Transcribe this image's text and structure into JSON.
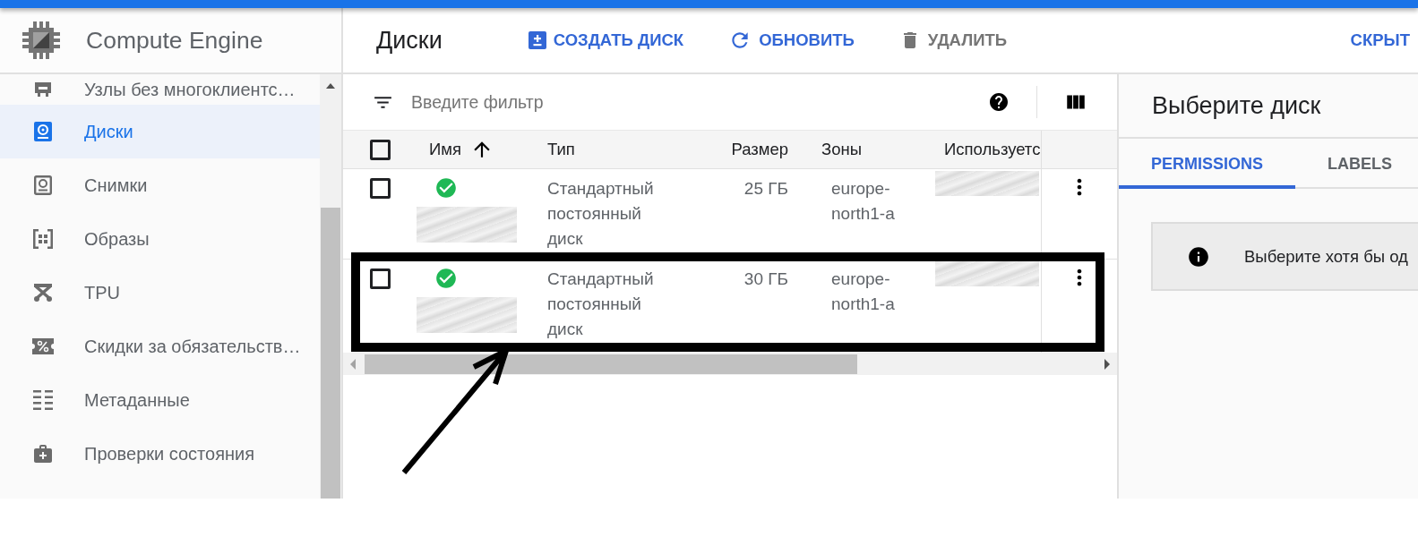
{
  "product": {
    "title": "Compute Engine"
  },
  "sidebar": {
    "items": [
      {
        "label": "Узлы без многоклиентс…",
        "selected": false
      },
      {
        "label": "Диски",
        "selected": true
      },
      {
        "label": "Снимки",
        "selected": false
      },
      {
        "label": "Образы",
        "selected": false
      },
      {
        "label": "TPU",
        "selected": false
      },
      {
        "label": "Скидки за обязательств…",
        "selected": false
      },
      {
        "label": "Метаданные",
        "selected": false
      },
      {
        "label": "Проверки состояния",
        "selected": false
      }
    ]
  },
  "toolbar": {
    "title": "Диски",
    "actions": [
      {
        "kind": "create",
        "label": "СОЗДАТЬ ДИСК",
        "disabled": false
      },
      {
        "kind": "refresh",
        "label": "ОБНОВИТЬ",
        "disabled": false
      },
      {
        "kind": "delete",
        "label": "УДАЛИТЬ",
        "disabled": true
      }
    ],
    "panel_toggle": "СКРЫТ"
  },
  "filter": {
    "placeholder": "Введите фильтр"
  },
  "table": {
    "select_all": {
      "checked": false
    },
    "columns": [
      {
        "label": "Имя",
        "sorted": true
      },
      {
        "label": "Тип",
        "sorted": false
      },
      {
        "label": "Размер",
        "sorted": false
      },
      {
        "label": "Зоны",
        "sorted": false
      },
      {
        "label": "Используетс",
        "sorted": false
      }
    ],
    "rows": [
      {
        "checked": false,
        "ready": true,
        "name_hidden": true,
        "type": "Стандартный постоянный диск",
        "size": "25 ГБ",
        "zone": "europe-north1-a",
        "used_by_hidden": true,
        "highlighted": false
      },
      {
        "checked": false,
        "ready": true,
        "name_hidden": true,
        "type": "Стандартный постоянный диск",
        "size": "30 ГБ",
        "zone": "europe-north1-a",
        "used_by_hidden": true,
        "highlighted": true
      }
    ]
  },
  "details_panel": {
    "title": "Выберите диск",
    "tabs": [
      {
        "label": "PERMISSIONS",
        "selected": true
      },
      {
        "label": "LABELS",
        "selected": false
      }
    ],
    "notice": "Выберите хотя бы од"
  }
}
